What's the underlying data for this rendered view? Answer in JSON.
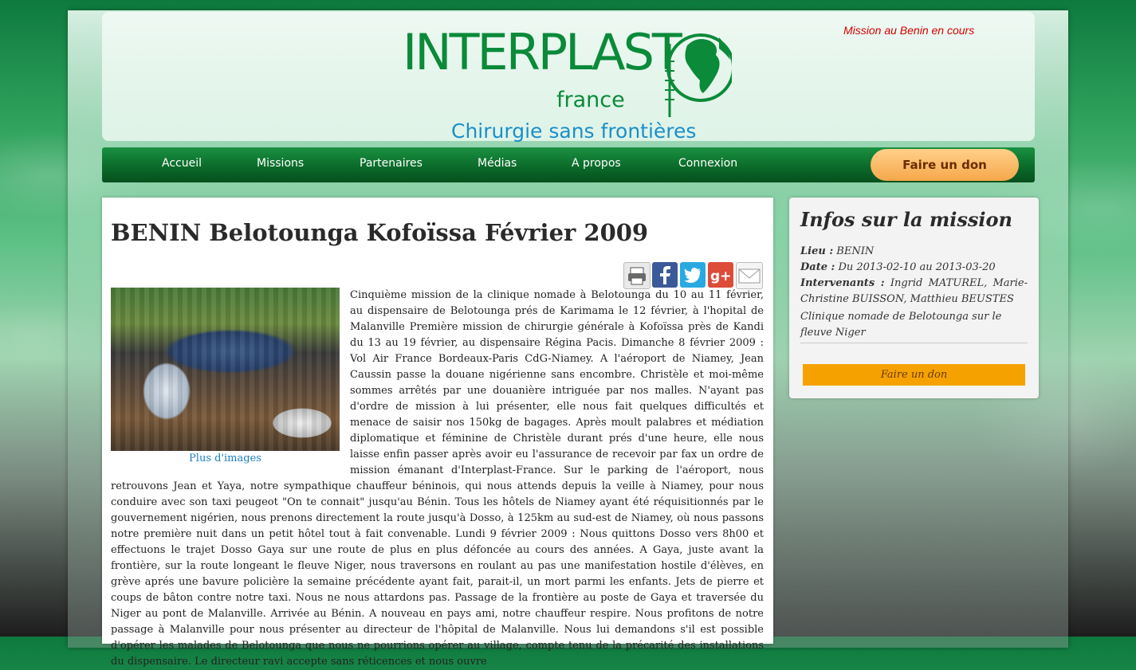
{
  "site": {
    "logo_word_1": "INTER",
    "logo_word_2": "PLAST",
    "logo_sub": "france",
    "tagline": "Chirurgie sans frontières",
    "mission_status": "Mission au Benin en cours"
  },
  "nav": {
    "items": [
      {
        "label": "Accueil"
      },
      {
        "label": "Missions"
      },
      {
        "label": "Partenaires"
      },
      {
        "label": "Médias"
      },
      {
        "label": "A propos"
      },
      {
        "label": "Connexion"
      }
    ],
    "donate_label": "Faire un don"
  },
  "article": {
    "title": "BENIN Belotounga Kofoïssa Février 2009",
    "share_icons": [
      "print-icon",
      "facebook-icon",
      "twitter-icon",
      "google-plus-icon",
      "email-icon"
    ],
    "more_images_label": "Plus d'images",
    "body": "Cinquième mission de la clinique nomade à Belotounga du 10 au 11 février, au dispensaire de Belotounga prés de Karimama le 12 février, à l'hopital de Malanville Première mission de chirurgie générale à Kofoïssa près de Kandi du 13 au 19 février, au dispensaire Régina Pacis. Dimanche 8 février 2009 : Vol Air France Bordeaux-Paris CdG-Niamey. A l'aéroport de Niamey, Jean Caussin passe la douane nigérienne sans encombre. Christèle et moi-même sommes arrêtés par une douanière intriguée par nos malles. N'ayant pas d'ordre de mission à lui présenter, elle nous fait quelques difficultés et menace de saisir nos 150kg de bagages. Après moult palabres et médiation diplomatique et féminine de Christèle durant prés d'une heure, elle nous laisse enfin passer après avoir eu l'assurance de recevoir par fax un ordre de mission émanant d'Interplast-France. Sur le parking de l'aéroport, nous retrouvons Jean et Yaya, notre sympathique chauffeur béninois, qui nous attends depuis la veille à Niamey, pour nous conduire avec son taxi peugeot \"On te connait\" jusqu'au Bénin. Tous les hôtels de Niamey ayant été réquisitionnés par le gouvernement nigérien, nous prenons directement la route jusqu'à Dosso, à 125km au sud-est de Niamey, où nous passons notre première nuit dans un petit hôtel tout à fait convenable. Lundi 9 février 2009 : Nous quittons Dosso vers 8h00 et effectuons le trajet Dosso Gaya sur une route de plus en plus défoncée au cours des années. A Gaya, juste avant la frontière, sur la route longeant le fleuve Niger, nous traversons en roulant au pas une manifestation hostile d'élèves, en grève aprés une bavure policière la semaine précédente ayant fait, parait-il, un mort parmi les enfants. Jets de pierre et coups de bâton contre notre taxi. Nous ne nous attardons pas. Passage de la frontière au poste de Gaya et traversée du Niger au pont de Malanville. Arrivée au Bénin. A nouveau en pays ami, notre chauffeur respire. Nous profitons de notre passage à Malanville pour nous présenter au directeur de l'hôpital de Malanville. Nous lui demandons s'il est possible d'opérer les malades de Belotounga que nous ne pourrions opérer au village, compte tenu de la précarité des installations du dispensaire. Le directeur ravi accepte sans réticences et nous ouvre"
  },
  "sidebar": {
    "title": "Infos sur la mission",
    "lieu_label": "Lieu :",
    "lieu_value": "BENIN",
    "date_label": "Date :",
    "date_value": "Du 2013-02-10 au 2013-03-20",
    "intervenants_label": "Intervenants :",
    "intervenants_value": "Ingrid MATUREL, Marie-Christine BUISSON, Matthieu BEUSTES",
    "description": "Clinique nomade de Belotounga sur le fleuve Niger",
    "donate_label": "Faire un don"
  },
  "colors": {
    "brand_green": "#0b8a3a",
    "brand_blue": "#1a8fc9",
    "donate_orange": "#f5a200",
    "status_red": "#d40000",
    "link_blue": "#1a7fc1"
  }
}
